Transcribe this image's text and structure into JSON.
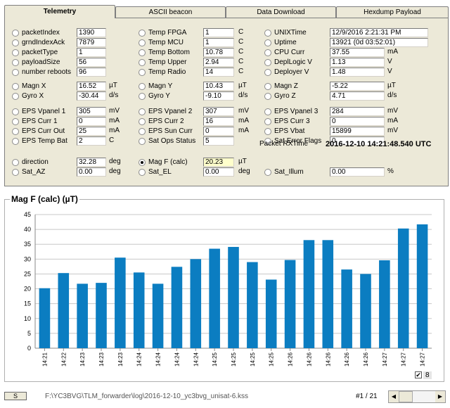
{
  "tabs": [
    "Telemetry",
    "ASCII beacon",
    "Data Download",
    "Hexdump Payload"
  ],
  "col1": [
    {
      "label": "packetIndex",
      "value": "1390",
      "unit": ""
    },
    {
      "label": "grndIndexAck",
      "value": "7879",
      "unit": ""
    },
    {
      "label": "packetType",
      "value": "1",
      "unit": ""
    },
    {
      "label": "payloadSize",
      "value": "56",
      "unit": ""
    },
    {
      "label": "number reboots",
      "value": "96",
      "unit": ""
    },
    {
      "label": "Magn X",
      "value": "16.52",
      "unit": "µT"
    },
    {
      "label": "Gyro X",
      "value": "-30.44",
      "unit": "d/s"
    },
    {
      "label": "EPS Vpanel 1",
      "value": "305",
      "unit": "mV"
    },
    {
      "label": "EPS Curr 1",
      "value": "0",
      "unit": "mA"
    },
    {
      "label": "EPS Curr Out",
      "value": "25",
      "unit": "mA"
    },
    {
      "label": "EPS Temp Bat",
      "value": "2",
      "unit": "C"
    },
    {
      "label": "direction",
      "value": "32.28",
      "unit": "deg"
    },
    {
      "label": "Sat_AZ",
      "value": "0.00",
      "unit": "deg"
    }
  ],
  "col2": [
    {
      "label": "Temp FPGA",
      "value": "1",
      "unit": "C"
    },
    {
      "label": "Temp MCU",
      "value": "1",
      "unit": "C"
    },
    {
      "label": "Temp Bottom",
      "value": "10.78",
      "unit": "C"
    },
    {
      "label": "Temp Upper",
      "value": "2.94",
      "unit": "C"
    },
    {
      "label": "Temp Radio",
      "value": "14",
      "unit": "C"
    },
    {
      "label": "Magn Y",
      "value": "10.43",
      "unit": "µT"
    },
    {
      "label": "Gyro Y",
      "value": "-9.10",
      "unit": "d/s"
    },
    {
      "label": "EPS Vpanel 2",
      "value": "307",
      "unit": "mV"
    },
    {
      "label": "EPS Curr 2",
      "value": "16",
      "unit": "mA"
    },
    {
      "label": "EPS Sun Curr",
      "value": "0",
      "unit": "mA"
    },
    {
      "label": "Sat Ops Status",
      "value": "5",
      "unit": ""
    },
    {
      "label": "Mag F (calc)",
      "value": "20.23",
      "unit": "µT"
    },
    {
      "label": "Sat_EL",
      "value": "0.00",
      "unit": "deg"
    }
  ],
  "col3": [
    {
      "label": "UNIXTime",
      "value": "12/9/2016 2:21:31 PM",
      "unit": ""
    },
    {
      "label": "Uptime",
      "value": "13921  (0d 03:52:01)",
      "unit": ""
    },
    {
      "label": "CPU Curr",
      "value": "37.55",
      "unit": "mA"
    },
    {
      "label": "DeplLogic V",
      "value": "1.13",
      "unit": "V"
    },
    {
      "label": "Deployer V",
      "value": "1.48",
      "unit": "V"
    },
    {
      "label": "Magn Z",
      "value": "-5.22",
      "unit": "µT"
    },
    {
      "label": "Gyro Z",
      "value": "4.71",
      "unit": "d/s"
    },
    {
      "label": "EPS Vpanel 3",
      "value": "284",
      "unit": "mV"
    },
    {
      "label": "EPS Curr 3",
      "value": "0",
      "unit": "mA"
    },
    {
      "label": "EPS Vbat",
      "value": "15899",
      "unit": "mV"
    },
    {
      "label": "Sat Error Flags",
      "value": "0",
      "unit": ""
    },
    {
      "label": "Packet RXTime",
      "value": "2016-12-10  14:21:48.540 UTC",
      "unit": ""
    },
    {
      "label": "Sat_Illum",
      "value": "0.00",
      "unit": "%"
    }
  ],
  "chart_data": {
    "type": "bar",
    "title": "Mag F (calc) (µT)",
    "categories": [
      "14:21",
      "14:22",
      "14:23",
      "14:23",
      "14:23",
      "14:24",
      "14:24",
      "14:24",
      "14:24",
      "14:25",
      "14:25",
      "14:25",
      "14:25",
      "14:26",
      "14:26",
      "14:26",
      "14:26",
      "14:26",
      "14:27",
      "14:27",
      "14:27"
    ],
    "values": [
      20.2,
      25.3,
      21.7,
      22.0,
      30.5,
      25.5,
      21.7,
      27.4,
      30.0,
      33.5,
      34.1,
      29.0,
      23.1,
      29.7,
      36.4,
      36.4,
      26.5,
      25.0,
      29.6,
      40.3,
      41.7
    ],
    "ylim": [
      0,
      45
    ],
    "yticks": [
      0,
      5,
      10,
      15,
      20,
      25,
      30,
      35,
      40,
      45
    ],
    "grid": true,
    "color": "#0b7dc1",
    "legend": {
      "label": "8",
      "checked": true,
      "placement": "bottom-right"
    }
  },
  "status": {
    "button_label": "S",
    "path": "F:\\YC3BVG\\TLM_forwarder\\log\\2016-12-10_yc3bvg_unisat-6.kss",
    "page": "#1 / 21"
  }
}
